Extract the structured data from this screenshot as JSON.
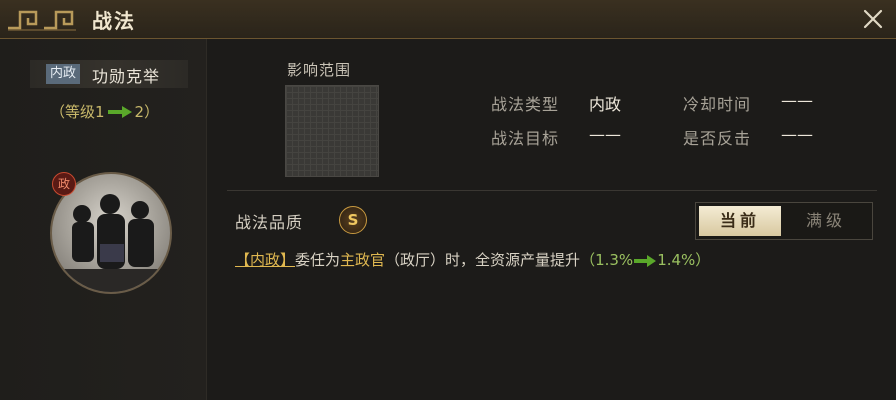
{
  "window": {
    "title": "战法"
  },
  "skill": {
    "type_tag": "内政",
    "name": "功勋克举",
    "level_prefix": "（等级1",
    "level_suffix": "2）",
    "portrait_badge": "政"
  },
  "range": {
    "label": "影响范围"
  },
  "info": {
    "type_label": "战法类型",
    "type_value": "内政",
    "cooldown_label": "冷却时间",
    "cooldown_value": "——",
    "target_label": "战法目标",
    "target_value": "——",
    "counter_label": "是否反击",
    "counter_value": "——"
  },
  "quality": {
    "label": "战法品质",
    "grade": "S"
  },
  "toggle": {
    "current": "当前",
    "max": "满级"
  },
  "description": {
    "tag": "【内政】",
    "part1": "委任为",
    "highlight": "主政官",
    "part2": "（政厅）时，全资源产量提升",
    "open": "（",
    "from": "1.3%",
    "to": "1.4%",
    "close": "）"
  },
  "colors": {
    "accent_gold": "#e0b850",
    "accent_green": "#9ac060",
    "background": "#1c1b19"
  }
}
